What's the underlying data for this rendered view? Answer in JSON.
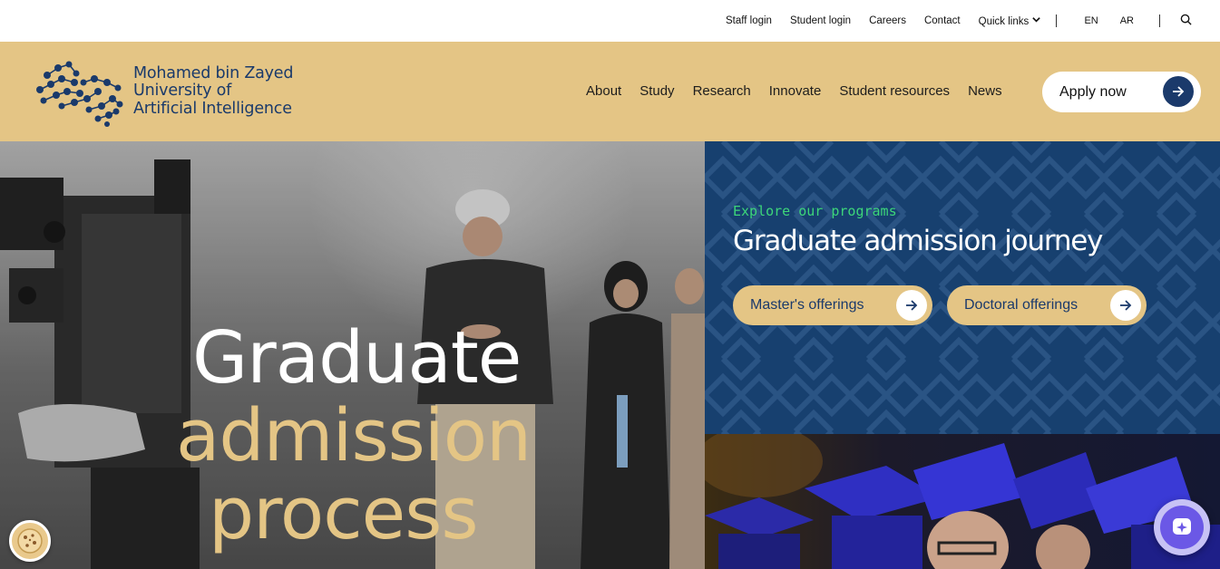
{
  "utility_bar": {
    "links": [
      "Staff login",
      "Student login",
      "Careers",
      "Contact"
    ],
    "quick_links": "Quick links",
    "languages": [
      "EN",
      "AR"
    ],
    "search_icon": "search-icon"
  },
  "header": {
    "logo_lines": [
      "Mohamed bin Zayed",
      "University of",
      "Artificial Intelligence"
    ],
    "nav": [
      "About",
      "Study",
      "Research",
      "Innovate",
      "Student resources",
      "News"
    ],
    "apply_label": "Apply now"
  },
  "hero": {
    "title_line1": "Graduate",
    "title_line2": "admission",
    "title_line3": "process"
  },
  "programs": {
    "eyebrow": "Explore our programs",
    "title": "Graduate admission journey",
    "buttons": [
      "Master's offerings",
      "Doctoral offerings"
    ]
  },
  "colors": {
    "gold": "#e4c585",
    "navy": "#17406f",
    "eyebrow_green": "#3dd67a",
    "chat_purple": "#6b58e6"
  },
  "icons": [
    "chevron-down-icon",
    "search-icon",
    "arrow-right-icon",
    "cookie-icon",
    "chat-icon"
  ]
}
